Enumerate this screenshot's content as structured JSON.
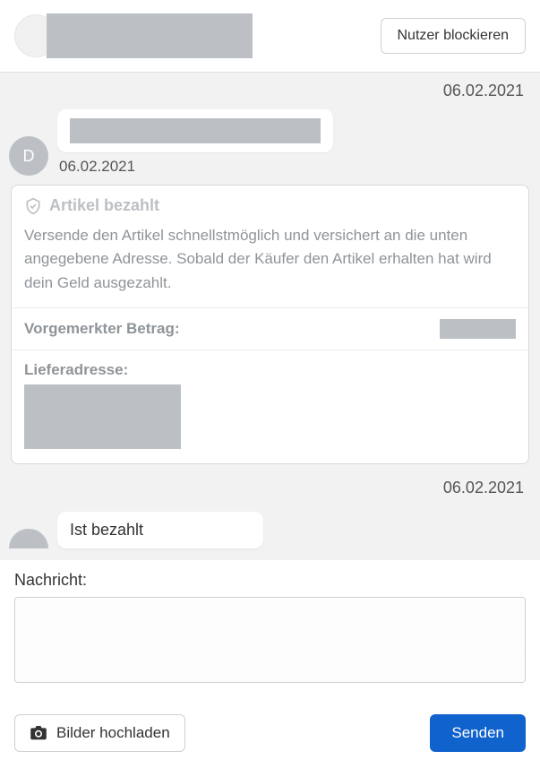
{
  "header": {
    "block_button": "Nutzer blockieren"
  },
  "conversation": {
    "date_separator_1": "06.02.2021",
    "avatar_initial": "D",
    "message_time_1": "06.02.2021",
    "date_separator_2": "06.02.2021",
    "message_2_text": "Ist bezahlt"
  },
  "payment_card": {
    "title": "Artikel bezahlt",
    "body": "Versende den Artikel schnellstmöglich und versichert an die unten angegebene Adresse. Sobald der Käufer den Artikel erhalten hat wird dein Geld ausgezahlt.",
    "reserved_label": "Vorgemerkter Betrag:",
    "address_label": "Lieferadresse:"
  },
  "compose": {
    "label": "Nachricht:",
    "placeholder": "",
    "upload_button": "Bilder hochladen",
    "send_button": "Senden"
  }
}
